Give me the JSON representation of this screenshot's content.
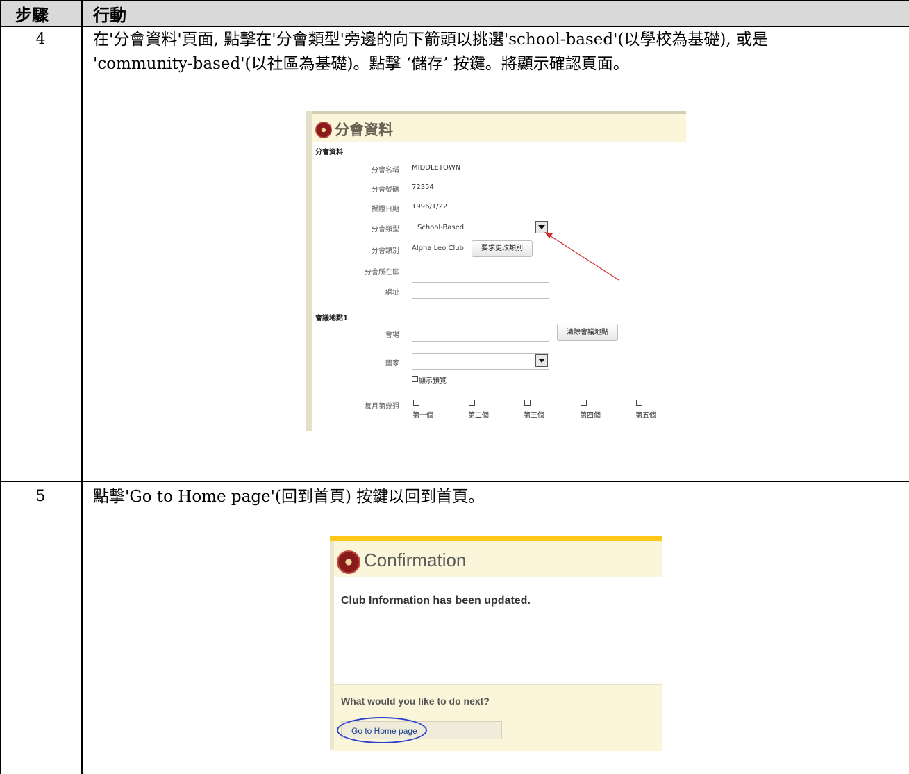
{
  "table": {
    "header": {
      "step": "步驟",
      "action": "行動"
    },
    "rows": [
      {
        "step": "4",
        "line1": "在'分會資料'頁面, 點擊在'分會類型'旁邊的向下箭頭以挑選'school-based'(以學校為基礎), 或是",
        "line2": "'community-based'(以社區為基礎)。點擊 ‘儲存’ 按鍵。將顯示確認頁面。"
      },
      {
        "step": "5",
        "line1": "點擊'Go to Home page'(回到首頁) 按鍵以回到首頁。"
      }
    ]
  },
  "club_info": {
    "title": "分會資料",
    "section": "分會資料",
    "fields": {
      "name_label": "分會名稱",
      "name_value": "MIDDLETOWN",
      "number_label": "分會號碼",
      "number_value": "72354",
      "charter_label": "授證日期",
      "charter_value": "1996/1/22",
      "type_label": "分會類型",
      "type_value": "School-Based",
      "category_label": "分會類別",
      "category_value": "Alpha Leo Club",
      "category_button": "要求更改類別",
      "district_label": "分會所在區",
      "website_label": "網址"
    },
    "meeting": {
      "section": "會議地點1",
      "venue_label": "會場",
      "clear_button": "清除會議地點",
      "country_label": "國家",
      "preview_label": "顯示預覽",
      "week_label": "每月第幾週",
      "weeks": [
        "第一個",
        "第二個",
        "第三個",
        "第四個",
        "第五個"
      ]
    },
    "arrow_color": "#d62a2a"
  },
  "confirmation": {
    "title": "Confirmation",
    "message": "Club Information has been updated.",
    "next_question": "What would you like to do next?",
    "home_button": "Go to Home page",
    "highlight_color": "#2a3fd0"
  }
}
